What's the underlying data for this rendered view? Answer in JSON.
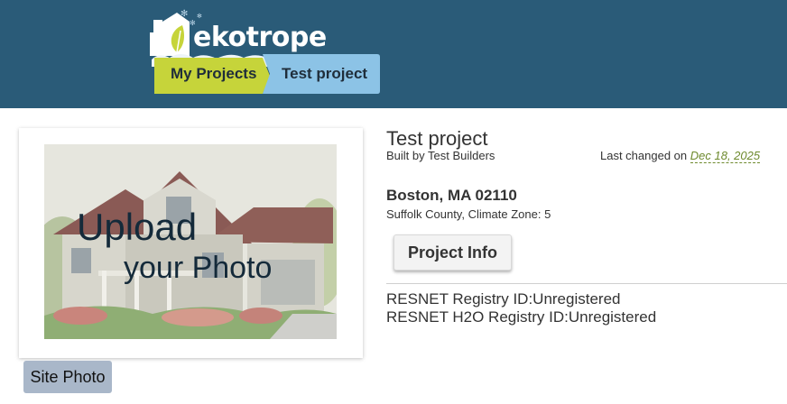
{
  "header": {
    "logo_text": "ekotrope",
    "breadcrumbs": [
      {
        "label": "My Projects",
        "color": "#c6d43a"
      },
      {
        "label": "Test project",
        "color": "#8cc3e6"
      }
    ],
    "background": "#2a5b78"
  },
  "photo": {
    "overlay_line1": "Upload",
    "overlay_line2": "your Photo",
    "site_photo_button": "Site Photo"
  },
  "project": {
    "title": "Test project",
    "built_by": "Built by Test Builders",
    "last_changed_label": "Last changed on",
    "last_changed_date": "Dec 18, 2025",
    "location": "Boston, MA 02110",
    "county": "Suffolk County, Climate Zone: 5",
    "info_button": "Project Info",
    "resnet_registry": "RESNET Registry ID:Unregistered",
    "resnet_h2o_registry": "RESNET H2O Registry ID:Unregistered"
  }
}
